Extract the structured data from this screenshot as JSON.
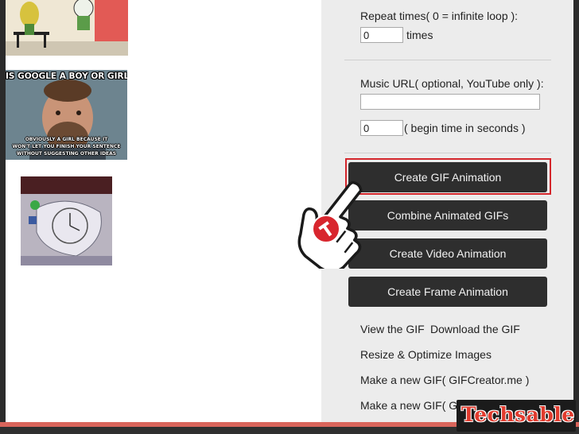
{
  "thumbnails": {
    "meme": {
      "top_text": "IS GOOGLE A BOY OR GIRL?",
      "bottom_line1": "OBVIOUSLY A GIRL BECAUSE IT",
      "bottom_line2": "WON'T LET YOU FINISH YOUR SENTENCE",
      "bottom_line3": "WITHOUT SUGGESTING OTHER IDEAS"
    }
  },
  "form": {
    "repeat_label": "Repeat times( 0 = infinite loop ):",
    "repeat_value": "0",
    "repeat_suffix": "times",
    "music_label": "Music URL( optional, YouTube only ):",
    "music_value": "",
    "begin_value": "0",
    "begin_suffix": "( begin time in seconds )"
  },
  "buttons": {
    "create_gif": "Create GIF Animation",
    "combine_gifs": "Combine Animated GIFs",
    "create_video": "Create Video Animation",
    "create_frame": "Create Frame Animation"
  },
  "links": {
    "view_gif": "View the GIF",
    "download_gif": "Download the GIF",
    "resize": "Resize & Optimize Images",
    "new_gif_1": "Make a new GIF( GIFCreator.me )",
    "new_gif_2": "Make a new GIF( G"
  },
  "watermark": {
    "brand": "Techsable"
  },
  "colors": {
    "button_bg": "#2e2e2e",
    "highlight": "#d4262c",
    "accent": "#e13b2e"
  }
}
